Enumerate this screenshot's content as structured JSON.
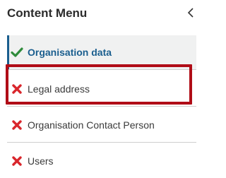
{
  "menu": {
    "title": "Content Menu",
    "collapse_icon": "chevron-left-icon",
    "items": [
      {
        "label": "Organisation data",
        "status": "complete",
        "icon": "checkmark-icon",
        "status_color": "#2e8b3a",
        "active": true
      },
      {
        "label": "Legal address",
        "status": "incomplete",
        "icon": "x-icon",
        "status_color": "#d9262c"
      },
      {
        "label": "Organisation Contact Person",
        "status": "incomplete",
        "icon": "x-icon",
        "status_color": "#d9262c"
      },
      {
        "label": "Users",
        "status": "incomplete",
        "icon": "x-icon",
        "status_color": "#d9262c"
      }
    ]
  },
  "colors": {
    "accent": "#1a5e8e",
    "active_background": "#f0f1f1",
    "highlight_box": "#b00d17"
  }
}
